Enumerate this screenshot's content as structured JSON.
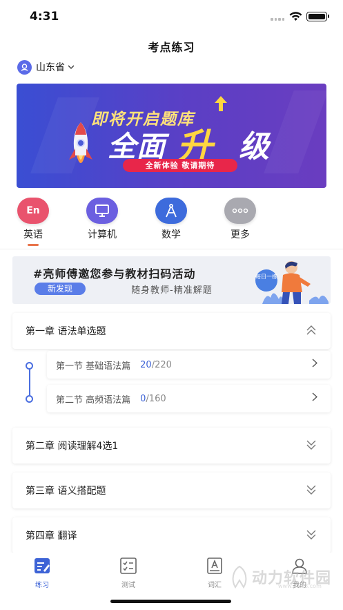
{
  "status_bar": {
    "time": "4:31"
  },
  "header": {
    "title": "考点练习",
    "location": "山东省"
  },
  "banner": {
    "line1": "即将开启题库",
    "line2_part1": "全面",
    "line2_part2": "升",
    "line2_part3": "级",
    "pill": "全新体验 敬请期待"
  },
  "categories": [
    {
      "label": "英语",
      "icon_text": "En",
      "icon": "english-icon",
      "color": "#e9536d",
      "active": true
    },
    {
      "label": "计算机",
      "icon": "computer-icon",
      "color": "#6b5fe0",
      "active": false
    },
    {
      "label": "数学",
      "icon": "math-compass-icon",
      "color": "#3d6bdc",
      "active": false
    },
    {
      "label": "更多",
      "icon": "more-icon",
      "color": "#a9a9b0",
      "active": false
    }
  ],
  "promo": {
    "title": "#亮师傅邀您参与教材扫码活动",
    "tag": "新发现",
    "subtitle": "随身教师-精准解题",
    "bubble": "每日一练"
  },
  "chapters": [
    {
      "label": "第一章 语法单选题",
      "expanded": true,
      "sections": [
        {
          "label": "第一节 基础语法篇",
          "done": "20",
          "total": "/220"
        },
        {
          "label": "第二节 高频语法篇",
          "done": "0",
          "total": "/160"
        }
      ]
    },
    {
      "label": "第二章 阅读理解4选1",
      "expanded": false
    },
    {
      "label": "第三章 语义搭配题",
      "expanded": false
    },
    {
      "label": "第四章 翻译",
      "expanded": false
    }
  ],
  "tabbar": [
    {
      "label": "练习",
      "icon": "practice-icon",
      "active": true
    },
    {
      "label": "测试",
      "icon": "test-icon",
      "active": false
    },
    {
      "label": "词汇",
      "icon": "vocabulary-icon",
      "active": false
    },
    {
      "label": "我的",
      "icon": "profile-icon",
      "active": false
    }
  ],
  "watermark": {
    "text": "动力软件园",
    "url": "www.pw88.com"
  },
  "colors": {
    "accent": "#3d63d6",
    "banner_bg": "#4a4ad0",
    "pill": "#e8264a"
  }
}
